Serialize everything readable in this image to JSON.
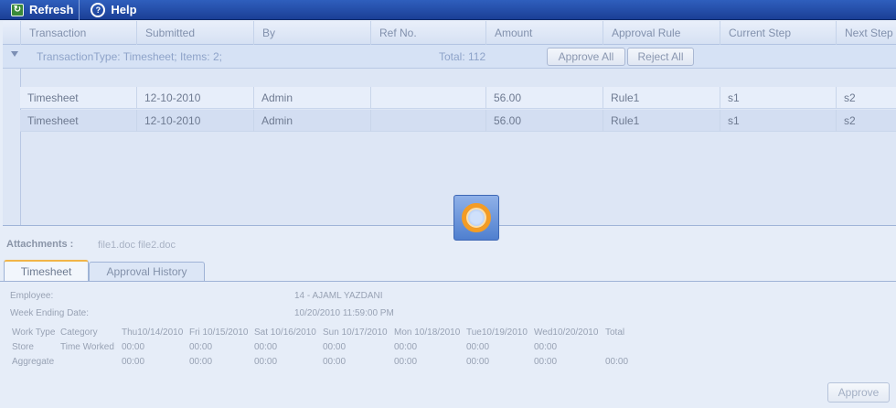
{
  "toolbar": {
    "refresh_label": "Refresh",
    "help_label": "Help"
  },
  "grid": {
    "columns": [
      "Transaction",
      "Submitted",
      "By",
      "Ref No.",
      "Amount",
      "Approval Rule",
      "Current Step",
      "Next Step"
    ],
    "group": {
      "label": "TransactionType: Timesheet; Items: 2;",
      "total": "Total: 112",
      "approve_all": "Approve All",
      "reject_all": "Reject All"
    },
    "rows": [
      [
        "Timesheet",
        "12-10-2010",
        "Admin",
        "",
        "56.00",
        "Rule1",
        "s1",
        "s2"
      ],
      [
        "Timesheet",
        "12-10-2010",
        "Admin",
        "",
        "56.00",
        "Rule1",
        "s1",
        "s2"
      ]
    ]
  },
  "details": {
    "attachments_label": "Attachments :",
    "attachments_files": "file1.doc file2.doc",
    "tabs": [
      "Timesheet",
      "Approval History"
    ],
    "employee_label": "Employee:",
    "employee_value": "14 - AJAML YAZDANI",
    "week_ending_label": "Week Ending Date:",
    "week_ending_value": "10/20/2010 11:59:00 PM",
    "table": {
      "col_worktype": "Work Type",
      "col_category": "Category",
      "day_headers": [
        "Thu10/14/2010",
        "Fri 10/15/2010",
        "Sat 10/16/2010",
        "Sun 10/17/2010",
        "Mon 10/18/2010",
        "Tue10/19/2010",
        "Wed10/20/2010",
        "Total"
      ],
      "store_label": "Store",
      "time_worked_label": "Time Worked",
      "store_values": [
        "00:00",
        "00:00",
        "00:00",
        "00:00",
        "00:00",
        "00:00",
        "00:00"
      ],
      "aggregate_label": "Aggregate",
      "aggregate_values": [
        "00:00",
        "00:00",
        "00:00",
        "00:00",
        "00:00",
        "00:00",
        "00:00",
        "00:00"
      ]
    },
    "approve_label": "Approve"
  }
}
